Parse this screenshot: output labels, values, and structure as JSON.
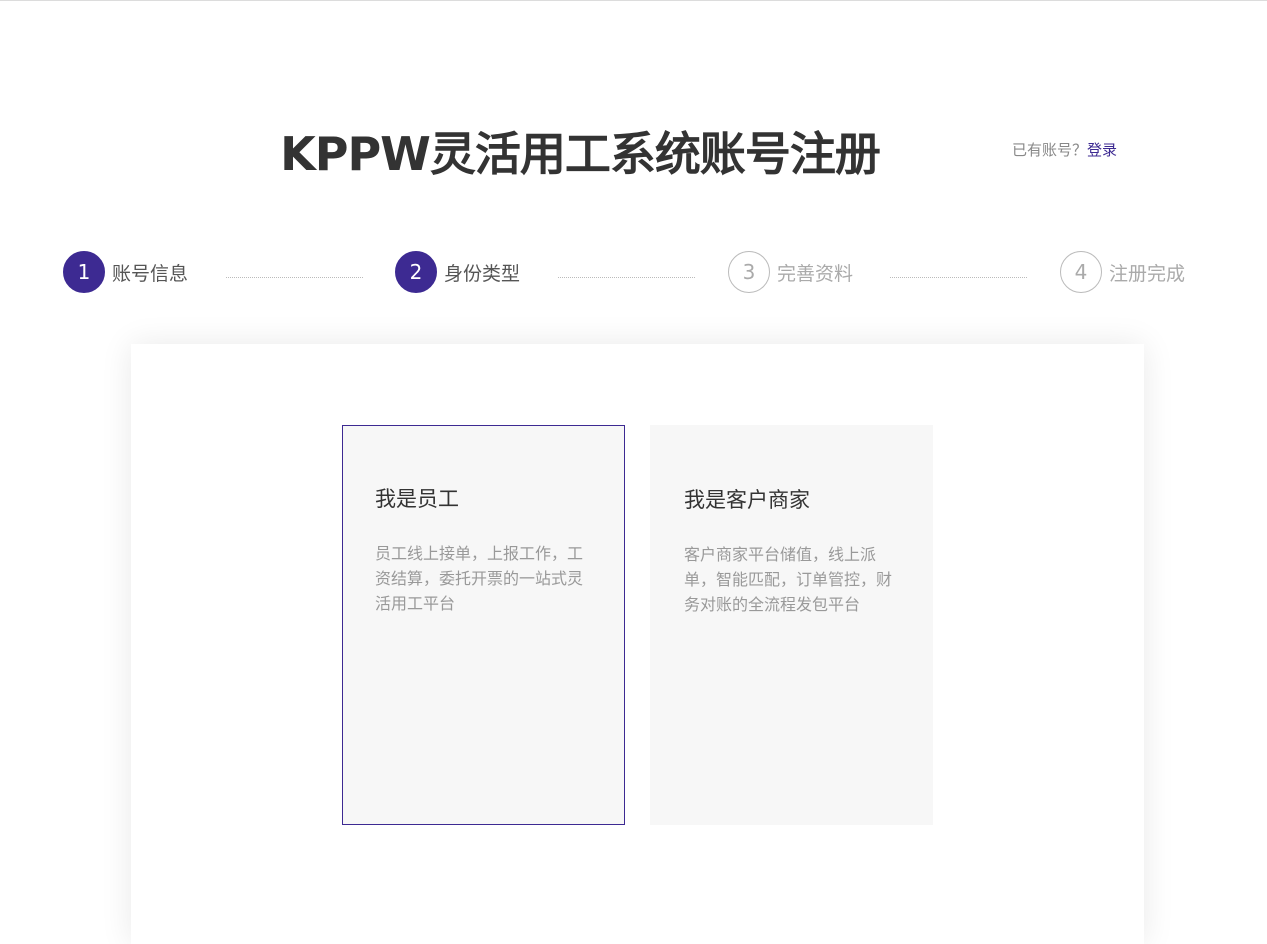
{
  "header": {
    "title": "KPPW灵活用工系统账号注册",
    "login_prompt": "已有账号？",
    "login_link": "登录"
  },
  "steps": [
    {
      "number": "1",
      "label": "账号信息",
      "state": "done"
    },
    {
      "number": "2",
      "label": "身份类型",
      "state": "current"
    },
    {
      "number": "3",
      "label": "完善资料",
      "state": "pending"
    },
    {
      "number": "4",
      "label": "注册完成",
      "state": "pending"
    }
  ],
  "roles": [
    {
      "title": "我是员工",
      "description": "员工线上接单，上报工作，工资结算，委托开票的一站式灵活用工平台",
      "selected": true
    },
    {
      "title": "我是客户商家",
      "description": "客户商家平台储值，线上派单，智能匹配，订单管控，财务对账的全流程发包平台",
      "selected": false
    }
  ],
  "colors": {
    "accent": "#3d2a92",
    "card_bg": "#f7f7f7",
    "title": "#333333",
    "muted": "#999999"
  }
}
